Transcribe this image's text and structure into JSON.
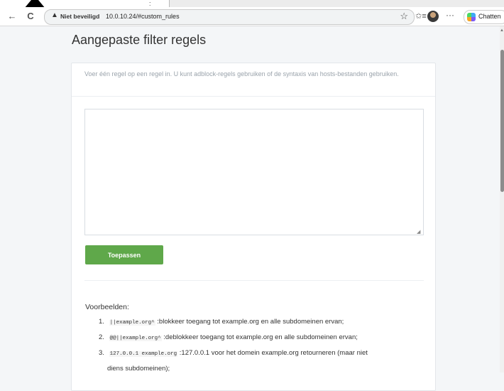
{
  "browser": {
    "tab_mark": ":",
    "back_icon": "←",
    "reload_icon": "C",
    "insecure_label": "Niet beveiligd",
    "url": "10.0.10.24/#custom_rules",
    "star_icon": "☆",
    "favorites_icon": "✩≡",
    "menu_icon": "···",
    "copilot_label": "Chatten"
  },
  "page": {
    "title": "Aangepaste filter regels",
    "description": "Voer één regel op een regel in. U kunt adblock-regels gebruiken of de syntaxis van hosts-bestanden gebruiken.",
    "textarea_value": "",
    "resize_glyph": "◢",
    "apply_label": "Toepassen",
    "examples_title": "Voorbeelden:",
    "examples": [
      {
        "num": "1.",
        "code": "||example.org^",
        "text": " :blokkeer toegang tot example.org en alle subdomeinen ervan;"
      },
      {
        "num": "2.",
        "code": "@@||example.org^",
        "text": " :deblokkeer toegang tot example.org en alle subdomeinen ervan;"
      },
      {
        "num": "3.",
        "code": "127.0.0.1 example.org",
        "text": " :127.0.0.1 voor het domein example.org retourneren (maar niet"
      },
      {
        "num": "",
        "code": "",
        "text": "diens subdomeinen);"
      }
    ]
  },
  "scrollbar": {
    "up_icon": "▲"
  }
}
